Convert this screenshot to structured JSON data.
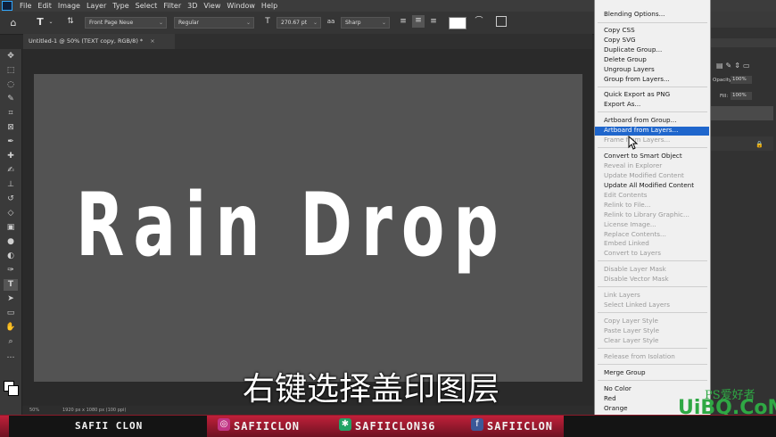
{
  "menubar": {
    "items": [
      "File",
      "Edit",
      "Image",
      "Layer",
      "Type",
      "Select",
      "Filter",
      "3D",
      "View",
      "Window",
      "Help"
    ]
  },
  "options": {
    "font_family": "Front Page Neue",
    "font_style": "Regular",
    "font_size": "270.67 pt",
    "antialias": "Sharp",
    "aa_label": "aa"
  },
  "document": {
    "tab_title": "Untitled-1 @ 50% (TEXT copy, RGB/8) *",
    "canvas_text": "Rain Drop"
  },
  "status": {
    "zoom": "50%",
    "doc_info": "1920 px x 1080 px (100 ppi)"
  },
  "right_panel": {
    "opacity_label": "Opacity:",
    "opacity_value": "100%",
    "fill_label": "Fill:",
    "fill_value": "100%"
  },
  "context_menu": {
    "items": [
      {
        "label": "Blending Options...",
        "enabled": true
      },
      {
        "label": "Copy CSS",
        "enabled": true
      },
      {
        "label": "Copy SVG",
        "enabled": true
      },
      {
        "label": "Duplicate Group...",
        "enabled": true
      },
      {
        "label": "Delete Group",
        "enabled": true
      },
      {
        "label": "Ungroup Layers",
        "enabled": true
      },
      {
        "label": "Group from Layers...",
        "enabled": true
      },
      {
        "label": "Quick Export as PNG",
        "enabled": true
      },
      {
        "label": "Export As...",
        "enabled": true
      },
      {
        "label": "Artboard from Group...",
        "enabled": true
      },
      {
        "label": "Artboard from Layers...",
        "enabled": true,
        "highlighted": true
      },
      {
        "label": "Frame from Layers...",
        "enabled": false
      },
      {
        "label": "Convert to Smart Object",
        "enabled": true
      },
      {
        "label": "Reveal in Explorer",
        "enabled": false
      },
      {
        "label": "Update Modified Content",
        "enabled": false
      },
      {
        "label": "Update All Modified Content",
        "enabled": true
      },
      {
        "label": "Edit Contents",
        "enabled": false
      },
      {
        "label": "Relink to File...",
        "enabled": false
      },
      {
        "label": "Relink to Library Graphic...",
        "enabled": false
      },
      {
        "label": "License Image...",
        "enabled": false
      },
      {
        "label": "Replace Contents...",
        "enabled": false
      },
      {
        "label": "Embed Linked",
        "enabled": false
      },
      {
        "label": "Convert to Layers",
        "enabled": false
      },
      {
        "label": "Disable Layer Mask",
        "enabled": false
      },
      {
        "label": "Disable Vector Mask",
        "enabled": false
      },
      {
        "label": "Link Layers",
        "enabled": false
      },
      {
        "label": "Select Linked Layers",
        "enabled": false
      },
      {
        "label": "Copy Layer Style",
        "enabled": false
      },
      {
        "label": "Paste Layer Style",
        "enabled": false
      },
      {
        "label": "Clear Layer Style",
        "enabled": false
      },
      {
        "label": "Release from Isolation",
        "enabled": false
      },
      {
        "label": "Merge Group",
        "enabled": true
      },
      {
        "label": "No Color",
        "enabled": true
      },
      {
        "label": "Red",
        "enabled": true
      },
      {
        "label": "Orange",
        "enabled": true
      }
    ]
  },
  "subtitle": "右键选择盖印图层",
  "banner": {
    "name": "SAFIICLON",
    "name_spaced": "SAFII CLON",
    "instagram": "SAFIICLON",
    "other": "SAFIICLON36",
    "facebook": "SAFIICLON"
  },
  "watermark": {
    "main": "UiBQ.CoM",
    "small": "PS爱好者"
  },
  "colors": {
    "highlight": "#1f66cc",
    "banner_red": "#c0203a",
    "watermark": "#2fa844"
  }
}
